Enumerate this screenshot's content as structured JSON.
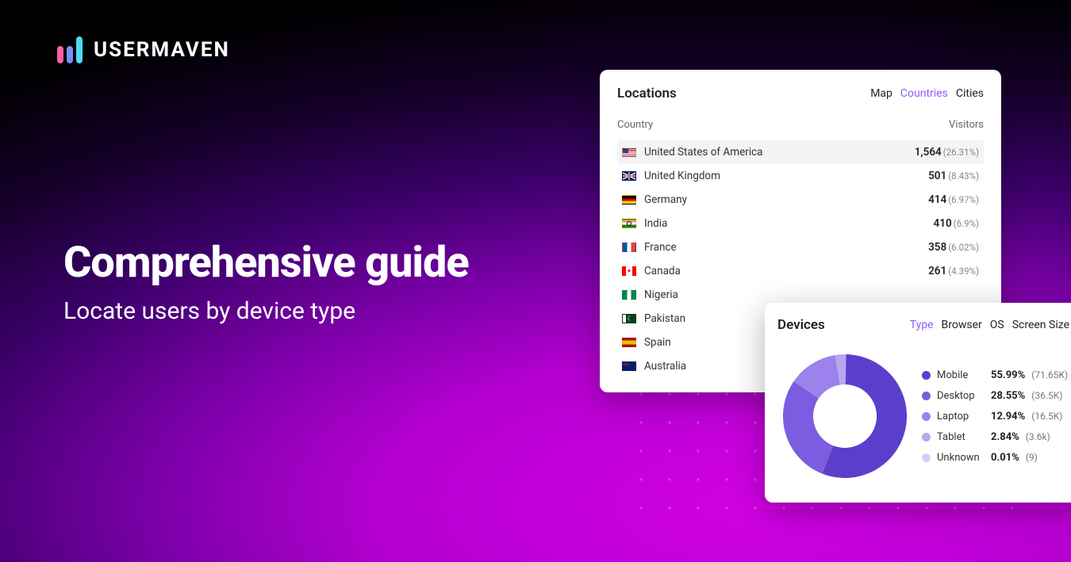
{
  "brand": {
    "name": "USERMAVEN"
  },
  "hero": {
    "title": "Comprehensive guide",
    "subtitle": "Locate users by device type"
  },
  "locations": {
    "title": "Locations",
    "tabs": [
      "Map",
      "Countries",
      "Cities"
    ],
    "active_tab": "Countries",
    "col_left": "Country",
    "col_right": "Visitors",
    "rows": [
      {
        "flag": "us",
        "name": "United States of America",
        "visitors": "1,564",
        "pct": "(26.31%)",
        "hl": true
      },
      {
        "flag": "uk",
        "name": "United Kingdom",
        "visitors": "501",
        "pct": "(8.43%)"
      },
      {
        "flag": "de",
        "name": "Germany",
        "visitors": "414",
        "pct": "(6.97%)"
      },
      {
        "flag": "in",
        "name": "India",
        "visitors": "410",
        "pct": "(6.9%)"
      },
      {
        "flag": "fr",
        "name": "France",
        "visitors": "358",
        "pct": "(6.02%)"
      },
      {
        "flag": "ca",
        "name": "Canada",
        "visitors": "261",
        "pct": "(4.39%)"
      },
      {
        "flag": "ng",
        "name": "Nigeria",
        "visitors": "",
        "pct": ""
      },
      {
        "flag": "pk",
        "name": "Pakistan",
        "visitors": "",
        "pct": ""
      },
      {
        "flag": "es",
        "name": "Spain",
        "visitors": "",
        "pct": ""
      },
      {
        "flag": "au",
        "name": "Australia",
        "visitors": "",
        "pct": ""
      }
    ]
  },
  "devices": {
    "title": "Devices",
    "tabs": [
      "Type",
      "Browser",
      "OS",
      "Screen Size"
    ],
    "active_tab": "Type",
    "legend": [
      {
        "label": "Mobile",
        "pct": "55.99%",
        "count": "(71.65K)",
        "color": "#5b3ecb"
      },
      {
        "label": "Desktop",
        "pct": "28.55%",
        "count": "(36.5K)",
        "color": "#7c5ce0"
      },
      {
        "label": "Laptop",
        "pct": "12.94%",
        "count": "(16.5K)",
        "color": "#9b82ec"
      },
      {
        "label": "Tablet",
        "pct": "2.84%",
        "count": "(3.6k)",
        "color": "#b8a6f2"
      },
      {
        "label": "Unknown",
        "pct": "0.01%",
        "count": "(9)",
        "color": "#d6ccf7"
      }
    ]
  },
  "chart_data": {
    "type": "pie",
    "title": "Devices",
    "series": [
      {
        "name": "Mobile",
        "value": 55.99,
        "count": 71650,
        "color": "#5b3ecb"
      },
      {
        "name": "Desktop",
        "value": 28.55,
        "count": 36500,
        "color": "#7c5ce0"
      },
      {
        "name": "Laptop",
        "value": 12.94,
        "count": 16500,
        "color": "#9b82ec"
      },
      {
        "name": "Tablet",
        "value": 2.84,
        "count": 3600,
        "color": "#b8a6f2"
      },
      {
        "name": "Unknown",
        "value": 0.01,
        "count": 9,
        "color": "#d6ccf7"
      }
    ]
  }
}
